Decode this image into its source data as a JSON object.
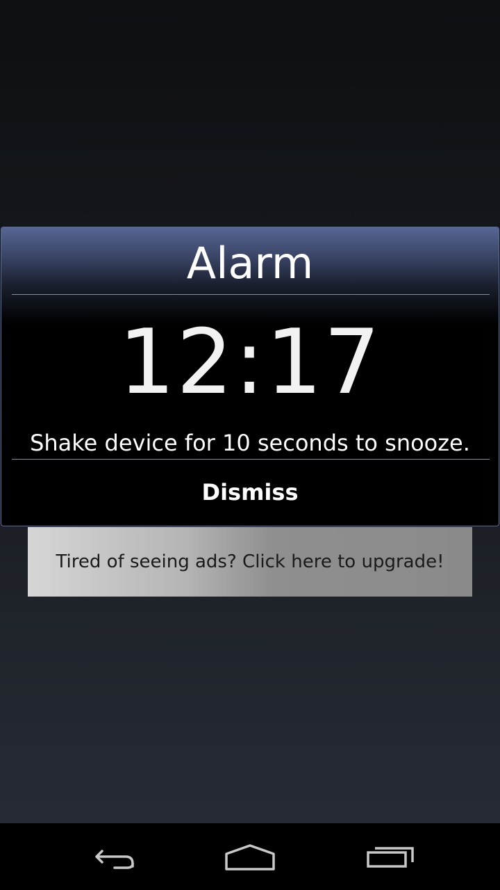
{
  "dialog": {
    "title": "Alarm",
    "time": "12:17",
    "message": "Shake device for 10 seconds to snooze.",
    "dismiss_label": "Dismiss"
  },
  "ad": {
    "text": "Tired of seeing ads? Click here to upgrade!"
  },
  "navbar": {
    "back_icon": "back-icon",
    "home_icon": "home-icon",
    "recent_icon": "recent-apps-icon"
  },
  "colors": {
    "header_accent": "#566593",
    "dialog_border": "#5a6a99",
    "dialog_bg": "#000000"
  }
}
